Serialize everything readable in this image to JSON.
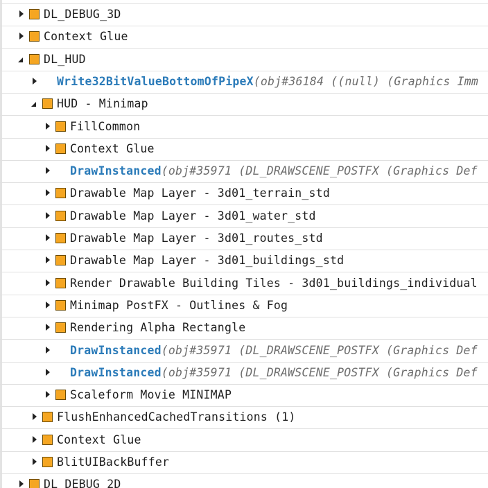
{
  "tree": {
    "rows": [
      {
        "level": 1,
        "kind": "marker",
        "state": "collapsed",
        "label": "DL_DEBUG_3D"
      },
      {
        "level": 1,
        "kind": "marker",
        "state": "collapsed",
        "label": "Context Glue"
      },
      {
        "level": 1,
        "kind": "marker",
        "state": "expanded",
        "label": "DL_HUD"
      },
      {
        "level": 2,
        "kind": "call",
        "state": "collapsed",
        "name": "Write32BitValueBottomOfPipeX",
        "args": "(obj#36184 ((null) (Graphics Imm"
      },
      {
        "level": 2,
        "kind": "marker",
        "state": "expanded",
        "label": "HUD - Minimap"
      },
      {
        "level": 3,
        "kind": "marker",
        "state": "collapsed",
        "label": "FillCommon"
      },
      {
        "level": 3,
        "kind": "marker",
        "state": "collapsed",
        "label": "Context Glue"
      },
      {
        "level": 3,
        "kind": "call",
        "state": "collapsed",
        "name": "DrawInstanced",
        "args": "(obj#35971 (DL_DRAWSCENE_POSTFX (Graphics Def"
      },
      {
        "level": 3,
        "kind": "marker",
        "state": "collapsed",
        "label": "Drawable Map Layer - 3d01_terrain_std"
      },
      {
        "level": 3,
        "kind": "marker",
        "state": "collapsed",
        "label": "Drawable Map Layer - 3d01_water_std"
      },
      {
        "level": 3,
        "kind": "marker",
        "state": "collapsed",
        "label": "Drawable Map Layer - 3d01_routes_std"
      },
      {
        "level": 3,
        "kind": "marker",
        "state": "collapsed",
        "label": "Drawable Map Layer - 3d01_buildings_std"
      },
      {
        "level": 3,
        "kind": "marker",
        "state": "collapsed",
        "label": "Render Drawable Building Tiles - 3d01_buildings_individual"
      },
      {
        "level": 3,
        "kind": "marker",
        "state": "collapsed",
        "label": "Minimap PostFX - Outlines & Fog"
      },
      {
        "level": 3,
        "kind": "marker",
        "state": "collapsed",
        "label": "Rendering Alpha Rectangle"
      },
      {
        "level": 3,
        "kind": "call",
        "state": "collapsed",
        "name": "DrawInstanced",
        "args": "(obj#35971 (DL_DRAWSCENE_POSTFX (Graphics Def"
      },
      {
        "level": 3,
        "kind": "call",
        "state": "collapsed",
        "name": "DrawInstanced",
        "args": "(obj#35971 (DL_DRAWSCENE_POSTFX (Graphics Def"
      },
      {
        "level": 3,
        "kind": "marker",
        "state": "collapsed",
        "label": "Scaleform Movie MINIMAP"
      },
      {
        "level": 2,
        "kind": "marker",
        "state": "collapsed",
        "label": "FlushEnhancedCachedTransitions (1)"
      },
      {
        "level": 2,
        "kind": "marker",
        "state": "collapsed",
        "label": "Context Glue"
      },
      {
        "level": 2,
        "kind": "marker",
        "state": "collapsed",
        "label": "BlitUIBackBuffer"
      },
      {
        "level": 1,
        "kind": "marker",
        "state": "collapsed",
        "label": "DL_DEBUG_2D"
      }
    ]
  },
  "colors": {
    "marker_fill": "#f5a622",
    "call_name": "#2b7bb9",
    "call_args": "#6d6d6d"
  }
}
